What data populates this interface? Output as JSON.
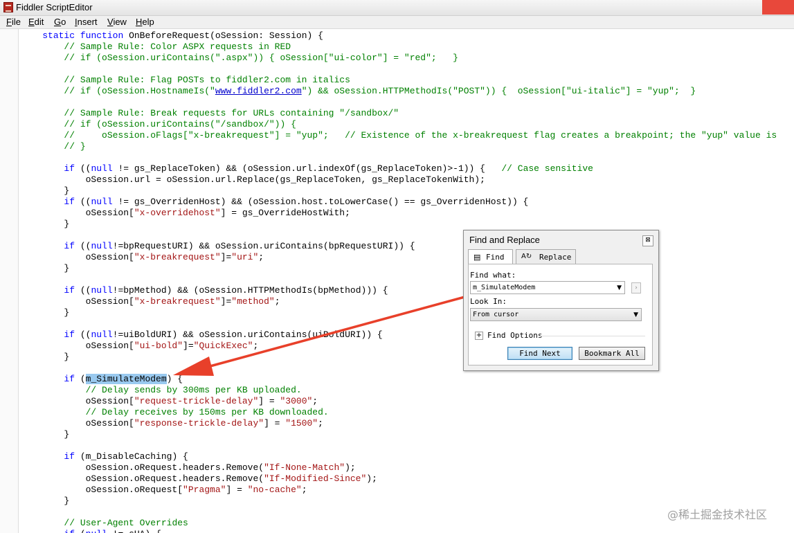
{
  "window": {
    "title": "Fiddler ScriptEditor"
  },
  "menu": [
    "File",
    "Edit",
    "Go",
    "Insert",
    "View",
    "Help"
  ],
  "code": {
    "lines": [
      [
        {
          "t": "    "
        },
        {
          "t": "static",
          "c": "kw"
        },
        {
          "t": " "
        },
        {
          "t": "function",
          "c": "kw"
        },
        {
          "t": " OnBeforeRequest(oSession: Session) {"
        }
      ],
      [
        {
          "t": "        "
        },
        {
          "t": "// Sample Rule: Color ASPX requests in RED",
          "c": "cm"
        }
      ],
      [
        {
          "t": "        "
        },
        {
          "t": "// if (oSession.uriContains(\".aspx\")) { oSession[\"ui-color\"] = \"red\";   }",
          "c": "cm"
        }
      ],
      [],
      [
        {
          "t": "        "
        },
        {
          "t": "// Sample Rule: Flag POSTs to fiddler2.com in italics",
          "c": "cm"
        }
      ],
      [
        {
          "t": "        "
        },
        {
          "t": "// if (oSession.HostnameIs(\"",
          "c": "cm"
        },
        {
          "t": "www.fiddler2.com",
          "c": "ln"
        },
        {
          "t": "\") && oSession.HTTPMethodIs(\"POST\")) {  oSession[\"ui-italic\"] = \"yup\";  }",
          "c": "cm"
        }
      ],
      [],
      [
        {
          "t": "        "
        },
        {
          "t": "// Sample Rule: Break requests for URLs containing \"/sandbox/\"",
          "c": "cm"
        }
      ],
      [
        {
          "t": "        "
        },
        {
          "t": "// if (oSession.uriContains(\"/sandbox/\")) {",
          "c": "cm"
        }
      ],
      [
        {
          "t": "        "
        },
        {
          "t": "//     oSession.oFlags[\"x-breakrequest\"] = \"yup\";   // Existence of the x-breakrequest flag creates a breakpoint; the \"yup\" value is",
          "c": "cm"
        }
      ],
      [
        {
          "t": "        "
        },
        {
          "t": "// }",
          "c": "cm"
        }
      ],
      [],
      [
        {
          "t": "        "
        },
        {
          "t": "if",
          "c": "kw"
        },
        {
          "t": " (("
        },
        {
          "t": "null",
          "c": "kw"
        },
        {
          "t": " != gs_ReplaceToken) && (oSession.url.indexOf(gs_ReplaceToken)>-1)) {   "
        },
        {
          "t": "// Case sensitive",
          "c": "cm"
        }
      ],
      [
        {
          "t": "            oSession.url = oSession.url.Replace(gs_ReplaceToken, gs_ReplaceTokenWith);"
        }
      ],
      [
        {
          "t": "        }"
        }
      ],
      [
        {
          "t": "        "
        },
        {
          "t": "if",
          "c": "kw"
        },
        {
          "t": " (("
        },
        {
          "t": "null",
          "c": "kw"
        },
        {
          "t": " != gs_OverridenHost) && (oSession.host.toLowerCase() == gs_OverridenHost)) {"
        }
      ],
      [
        {
          "t": "            oSession["
        },
        {
          "t": "\"x-overridehost\"",
          "c": "st"
        },
        {
          "t": "] = gs_OverrideHostWith;"
        }
      ],
      [
        {
          "t": "        }"
        }
      ],
      [],
      [
        {
          "t": "        "
        },
        {
          "t": "if",
          "c": "kw"
        },
        {
          "t": " (("
        },
        {
          "t": "null",
          "c": "kw"
        },
        {
          "t": "!=bpRequestURI) && oSession.uriContains(bpRequestURI)) {"
        }
      ],
      [
        {
          "t": "            oSession["
        },
        {
          "t": "\"x-breakrequest\"",
          "c": "st"
        },
        {
          "t": "]="
        },
        {
          "t": "\"uri\"",
          "c": "st"
        },
        {
          "t": ";"
        }
      ],
      [
        {
          "t": "        }"
        }
      ],
      [],
      [
        {
          "t": "        "
        },
        {
          "t": "if",
          "c": "kw"
        },
        {
          "t": " (("
        },
        {
          "t": "null",
          "c": "kw"
        },
        {
          "t": "!=bpMethod) && (oSession.HTTPMethodIs(bpMethod))) {"
        }
      ],
      [
        {
          "t": "            oSession["
        },
        {
          "t": "\"x-breakrequest\"",
          "c": "st"
        },
        {
          "t": "]="
        },
        {
          "t": "\"method\"",
          "c": "st"
        },
        {
          "t": ";"
        }
      ],
      [
        {
          "t": "        }"
        }
      ],
      [],
      [
        {
          "t": "        "
        },
        {
          "t": "if",
          "c": "kw"
        },
        {
          "t": " (("
        },
        {
          "t": "null",
          "c": "kw"
        },
        {
          "t": "!=uiBoldURI) && oSession.uriContains(uiBoldURI)) {"
        }
      ],
      [
        {
          "t": "            oSession["
        },
        {
          "t": "\"ui-bold\"",
          "c": "st"
        },
        {
          "t": "]="
        },
        {
          "t": "\"QuickExec\"",
          "c": "st"
        },
        {
          "t": ";"
        }
      ],
      [
        {
          "t": "        }"
        }
      ],
      [],
      [
        {
          "t": "        "
        },
        {
          "t": "if",
          "c": "kw"
        },
        {
          "t": " ("
        },
        {
          "t": "m_SimulateModem",
          "c": "hl"
        },
        {
          "t": ") {"
        }
      ],
      [
        {
          "t": "            "
        },
        {
          "t": "// Delay sends by 300ms per KB uploaded.",
          "c": "cm"
        }
      ],
      [
        {
          "t": "            oSession["
        },
        {
          "t": "\"request-trickle-delay\"",
          "c": "st"
        },
        {
          "t": "] = "
        },
        {
          "t": "\"3000\"",
          "c": "st"
        },
        {
          "t": ";"
        }
      ],
      [
        {
          "t": "            "
        },
        {
          "t": "// Delay receives by 150ms per KB downloaded.",
          "c": "cm"
        }
      ],
      [
        {
          "t": "            oSession["
        },
        {
          "t": "\"response-trickle-delay\"",
          "c": "st"
        },
        {
          "t": "] = "
        },
        {
          "t": "\"1500\"",
          "c": "st"
        },
        {
          "t": ";"
        }
      ],
      [
        {
          "t": "        }"
        }
      ],
      [],
      [
        {
          "t": "        "
        },
        {
          "t": "if",
          "c": "kw"
        },
        {
          "t": " (m_DisableCaching) {"
        }
      ],
      [
        {
          "t": "            oSession.oRequest.headers.Remove("
        },
        {
          "t": "\"If-None-Match\"",
          "c": "st"
        },
        {
          "t": ");"
        }
      ],
      [
        {
          "t": "            oSession.oRequest.headers.Remove("
        },
        {
          "t": "\"If-Modified-Since\"",
          "c": "st"
        },
        {
          "t": ");"
        }
      ],
      [
        {
          "t": "            oSession.oRequest["
        },
        {
          "t": "\"Pragma\"",
          "c": "st"
        },
        {
          "t": "] = "
        },
        {
          "t": "\"no-cache\"",
          "c": "st"
        },
        {
          "t": ";"
        }
      ],
      [
        {
          "t": "        }"
        }
      ],
      [],
      [
        {
          "t": "        "
        },
        {
          "t": "// User-Agent Overrides",
          "c": "cm"
        }
      ],
      [
        {
          "t": "        "
        },
        {
          "t": "if",
          "c": "kw"
        },
        {
          "t": " ("
        },
        {
          "t": "null",
          "c": "kw"
        },
        {
          "t": " != sUA) {"
        }
      ]
    ]
  },
  "find_dialog": {
    "title": "Find and Replace",
    "close_glyph": "⊠",
    "tabs": {
      "find": "Find",
      "replace": "Replace"
    },
    "find_what_label": "Find what:",
    "find_what_value": "m_SimulateModem",
    "look_in_label": "Look In:",
    "look_in_value": "From cursor",
    "find_options_label": "Find Options",
    "find_next_label": "Find Next",
    "bookmark_all_label": "Bookmark All"
  },
  "colors": {
    "keyword": "#0000ff",
    "comment": "#008000",
    "string": "#a31515",
    "selection": "#99c9ef",
    "annotation_arrow": "#e8402a"
  },
  "watermark": "@稀土掘金技术社区"
}
